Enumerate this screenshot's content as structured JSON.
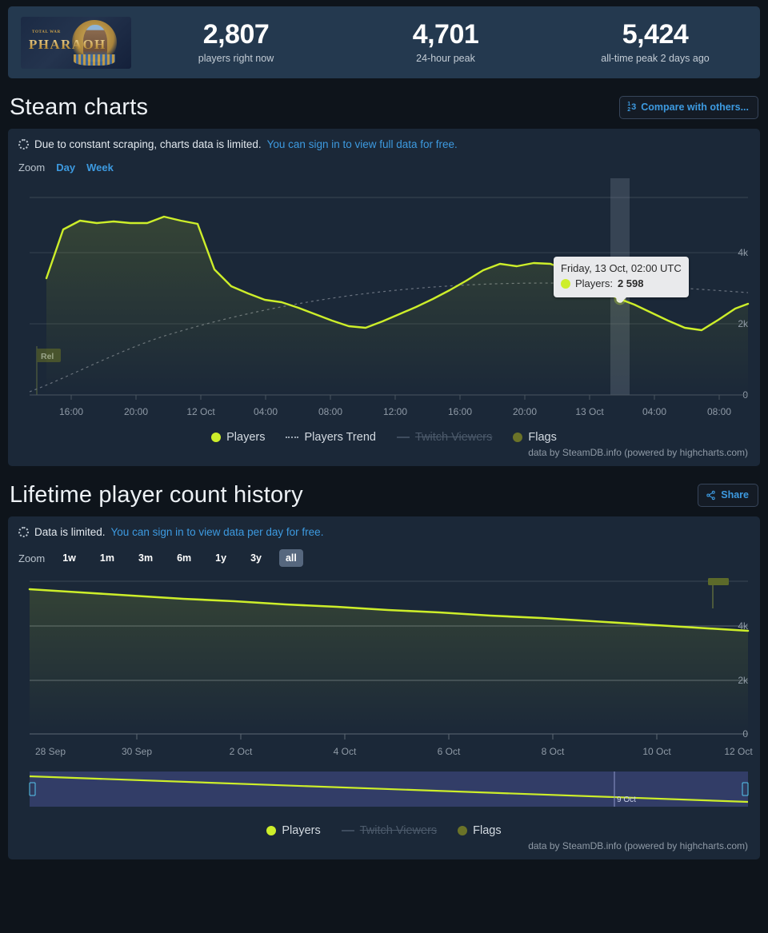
{
  "summary": {
    "game_title_small": "TOTAL WAR",
    "game_title": "PHARAOH",
    "stats": [
      {
        "value": "2,807",
        "label": "players right now"
      },
      {
        "value": "4,701",
        "label": "24-hour peak"
      },
      {
        "value": "5,424",
        "label": "all-time peak 2 days ago"
      }
    ]
  },
  "steam_charts": {
    "heading": "Steam charts",
    "compare_button": "Compare with others...",
    "compare_icon": "rank-icon",
    "notice_text": "Due to constant scraping, charts data is limited.",
    "notice_link": "You can sign in to view full data for free.",
    "zoom_label": "Zoom",
    "zoom_options": [
      "Day",
      "Week"
    ],
    "legend": [
      {
        "label": "Players",
        "marker": "dot",
        "color": "#d4f029",
        "disabled": false
      },
      {
        "label": "Players Trend",
        "marker": "dash",
        "color": "#9aa5b1",
        "disabled": false
      },
      {
        "label": "Twitch Viewers",
        "marker": "line",
        "color": "#3e4c5e",
        "disabled": true
      },
      {
        "label": "Flags",
        "marker": "dot",
        "color": "#6b7328",
        "disabled": false
      }
    ],
    "credit": "data by SteamDB.info (powered by highcharts.com)",
    "tooltip": {
      "time": "Friday, 13 Oct, 02:00 UTC",
      "series_label": "Players:",
      "series_value": "2 598",
      "marker_color": "#d4f029"
    },
    "flag_label": "Rel"
  },
  "lifetime": {
    "heading": "Lifetime player count history",
    "share_button": "Share",
    "share_icon": "share-icon",
    "notice_text": "Data is limited.",
    "notice_link": "You can sign in to view data per day for free.",
    "zoom_label": "Zoom",
    "zoom_options": [
      "1w",
      "1m",
      "3m",
      "6m",
      "1y",
      "3y",
      "all"
    ],
    "zoom_selected": "all",
    "navigator_label": "9 Oct",
    "legend": [
      {
        "label": "Players",
        "marker": "dot",
        "color": "#d4f029",
        "disabled": false
      },
      {
        "label": "Twitch Viewers",
        "marker": "line",
        "color": "#3e4c5e",
        "disabled": true
      },
      {
        "label": "Flags",
        "marker": "dot",
        "color": "#6b7328",
        "disabled": false
      }
    ],
    "credit": "data by SteamDB.info (powered by highcharts.com)"
  },
  "chart_data": [
    {
      "type": "line",
      "title": "Steam charts",
      "xlabel": "",
      "ylabel": "",
      "ylim": [
        0,
        5000
      ],
      "yticks": [
        0,
        2000,
        4000
      ],
      "ytick_labels": [
        "0",
        "2k",
        "4k"
      ],
      "grid": true,
      "legend_position": "bottom",
      "xtick_labels": [
        "16:00",
        "20:00",
        "12 Oct",
        "04:00",
        "08:00",
        "12:00",
        "16:00",
        "20:00",
        "13 Oct",
        "04:00",
        "08:00"
      ],
      "series": [
        {
          "name": "Players",
          "color": "#d4f029",
          "x": [
            "15:00",
            "16:00",
            "17:00",
            "18:00",
            "19:00",
            "20:00",
            "21:00",
            "22:00",
            "23:00",
            "00:00",
            "01:00",
            "02:00",
            "03:00",
            "04:00",
            "05:00",
            "06:00",
            "07:00",
            "08:00",
            "09:00",
            "10:00",
            "11:00",
            "12:00",
            "13:00",
            "14:00",
            "15:00",
            "16:00",
            "17:00",
            "18:00",
            "19:00",
            "20:00",
            "21:00",
            "22:00",
            "23:00",
            "00:00",
            "01:00",
            "02:00",
            "03:00",
            "04:00",
            "05:00",
            "06:00",
            "07:00",
            "08:00",
            "09:00"
          ],
          "values": [
            3270,
            4180,
            4420,
            4360,
            4400,
            4320,
            4320,
            4480,
            4400,
            4320,
            3520,
            3060,
            2860,
            2700,
            2620,
            2480,
            2300,
            2140,
            1980,
            1940,
            2120,
            2320,
            2520,
            2740,
            2980,
            3240,
            3540,
            3720,
            3660,
            3740,
            3720,
            3560,
            3260,
            2980,
            2780,
            2598,
            2420,
            2200,
            2000,
            1940,
            2240,
            2540,
            2700
          ]
        },
        {
          "name": "Players Trend",
          "color": "#6c7585",
          "style": "dashed",
          "values": [
            320,
            560,
            800,
            1030,
            1260,
            1480,
            1690,
            1880,
            2050,
            2200,
            2330,
            2440,
            2540,
            2620,
            2690,
            2760,
            2820,
            2880,
            2930,
            2970,
            3010,
            3040,
            3060,
            3080,
            3090,
            3100,
            3100,
            3090,
            3070,
            3050,
            3020,
            2990,
            2960,
            2930,
            2900,
            2870,
            2840,
            2820,
            2800,
            2790,
            2780,
            2780,
            2790
          ]
        },
        {
          "name": "Twitch Viewers",
          "color": "#3e4c5e",
          "disabled": true,
          "values": []
        }
      ],
      "annotations": [
        {
          "type": "flag",
          "label": "Rel",
          "x_frac": 0.012,
          "color": "#4a5226"
        },
        {
          "type": "crosshair",
          "x_frac": 0.818
        },
        {
          "type": "point",
          "label": "Players: 2 598",
          "value": 2598,
          "x_frac": 0.818
        }
      ]
    },
    {
      "type": "line",
      "title": "Lifetime player count history",
      "xlabel": "",
      "ylabel": "",
      "ylim": [
        0,
        6000
      ],
      "yticks": [
        0,
        2000,
        4000
      ],
      "ytick_labels": [
        "0",
        "2k",
        "4k"
      ],
      "grid": true,
      "legend_position": "bottom",
      "xtick_labels": [
        "28 Sep",
        "30 Sep",
        "2 Oct",
        "4 Oct",
        "6 Oct",
        "8 Oct",
        "10 Oct",
        "12 Oct"
      ],
      "series": [
        {
          "name": "Players",
          "color": "#d4f029",
          "x": [
            "28 Sep",
            "29 Sep",
            "30 Sep",
            "1 Oct",
            "2 Oct",
            "3 Oct",
            "4 Oct",
            "5 Oct",
            "6 Oct",
            "7 Oct",
            "8 Oct",
            "9 Oct",
            "10 Oct",
            "11 Oct",
            "12 Oct"
          ],
          "values": [
            5424,
            5350,
            5280,
            5200,
            5130,
            5060,
            4990,
            4920,
            4850,
            4780,
            4710,
            4640,
            4560,
            4490,
            4430
          ]
        },
        {
          "name": "Twitch Viewers",
          "color": "#3e4c5e",
          "disabled": true,
          "values": []
        }
      ],
      "annotations": [
        {
          "type": "flag",
          "x_frac": 0.932,
          "color": "#5c6a2a"
        }
      ],
      "navigator": {
        "label": "9 Oct",
        "selected_range": "full"
      }
    }
  ]
}
